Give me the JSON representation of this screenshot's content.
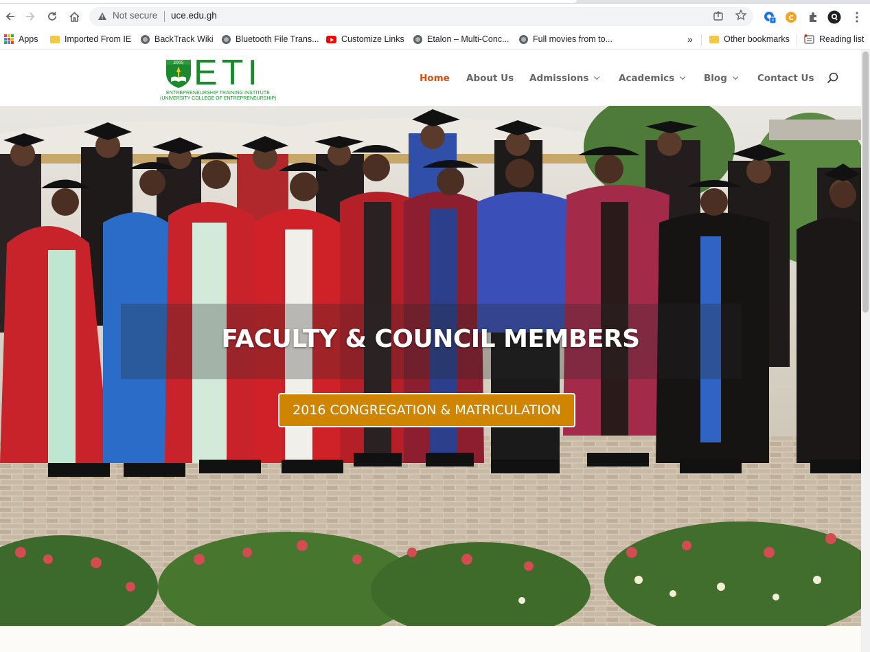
{
  "browser": {
    "security_label": "Not secure",
    "url": "uce.edu.gh"
  },
  "bookmarks": {
    "items": [
      {
        "label": "Apps",
        "icon": "apps-grid-icon"
      },
      {
        "label": "Imported From IE",
        "icon": "folder-icon"
      },
      {
        "label": "BackTrack Wiki",
        "icon": "globe-icon"
      },
      {
        "label": "Bluetooth File Trans...",
        "icon": "globe-icon"
      },
      {
        "label": "Customize Links",
        "icon": "youtube-icon"
      },
      {
        "label": "Etalon – Multi-Conc...",
        "icon": "globe-icon"
      },
      {
        "label": "Full movies from to...",
        "icon": "globe-icon"
      }
    ],
    "overflow": "»",
    "other": "Other bookmarks",
    "reading_list": "Reading list"
  },
  "logo": {
    "letters": "ETI",
    "line1": "ENTREPRENEURSHIP TRAINING INSTITUTE",
    "line2": "(UNIVERSITY COLLEGE OF ENTREPRENEURSHIP)",
    "brand_color": "#1b8a2e"
  },
  "nav": {
    "home": "Home",
    "about": "About Us",
    "admissions": "Admissions",
    "academics": "Academics",
    "blog": "Blog",
    "contact": "Contact Us",
    "active_color": "#e04e0e"
  },
  "hero": {
    "title": "FACULTY & COUNCIL MEMBERS",
    "button": "2016 CONGREGATION & MATRICULATION",
    "button_color": "#cf8500"
  }
}
